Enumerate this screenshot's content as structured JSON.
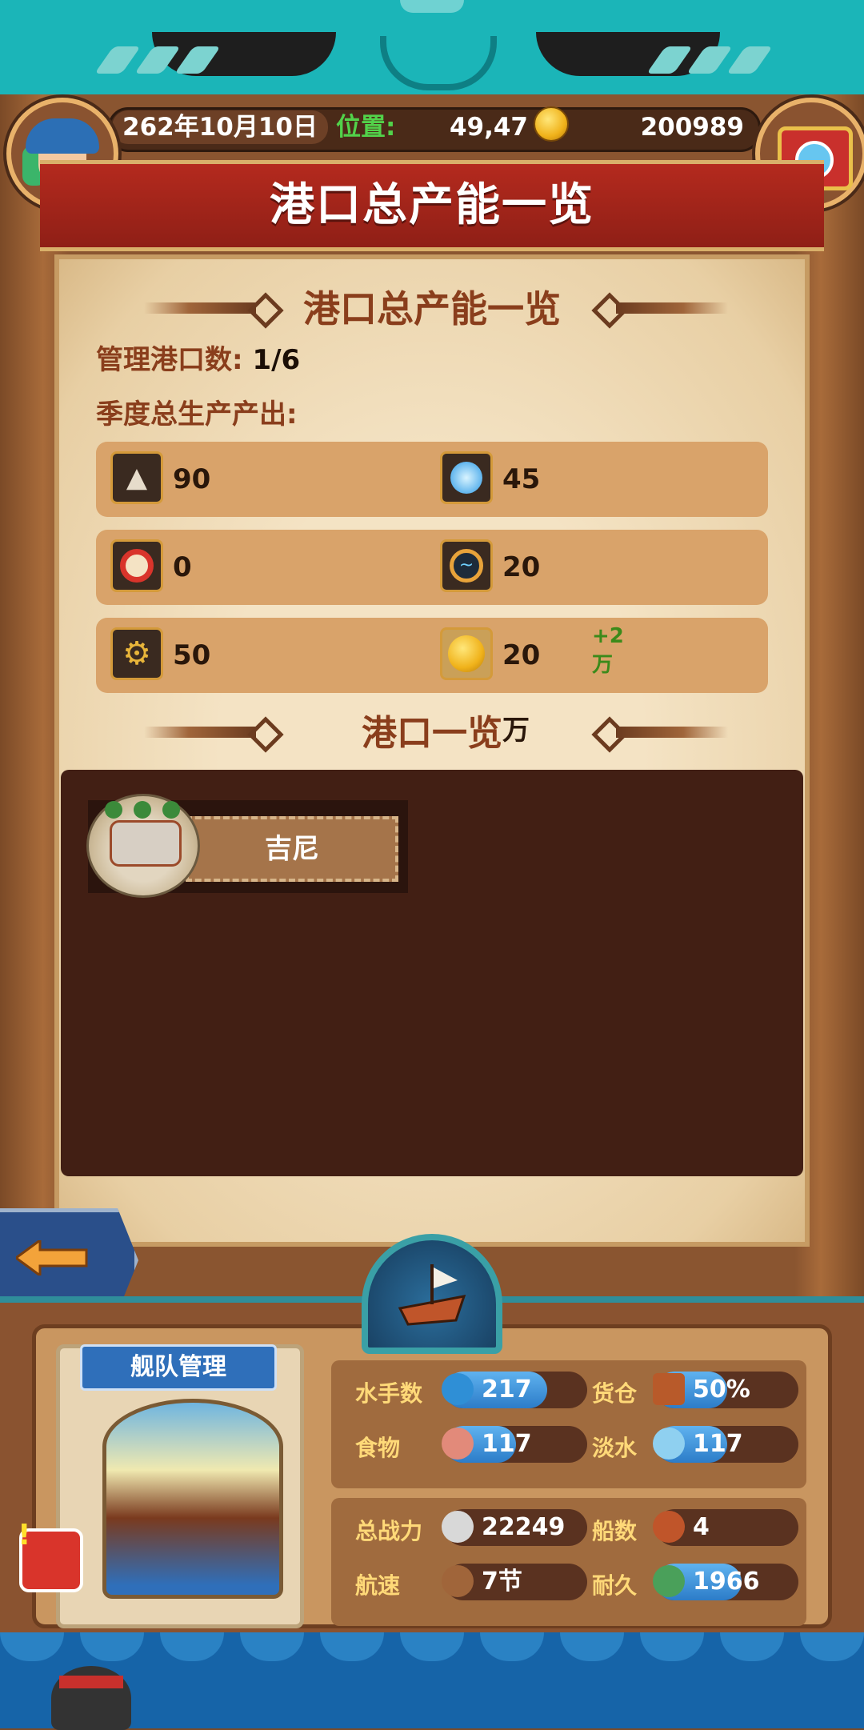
{
  "status": {
    "date": "262年10月10日",
    "position_label": "位置:",
    "position_value": "49,47",
    "gold": "200989"
  },
  "page_title": "港口总产能一览",
  "summary": {
    "heading": "港口总产能一览",
    "managed_label": "管理港口数:",
    "managed_value": "1/6",
    "output_label": "季度总生产产出:"
  },
  "resources": [
    {
      "icon": "stone-icon",
      "value": "90"
    },
    {
      "icon": "crystal-icon",
      "value": "45"
    },
    {
      "icon": "gear-badge-icon",
      "value": "0"
    },
    {
      "icon": "wind-icon",
      "value": "20"
    },
    {
      "icon": "cog-icon",
      "value": "50"
    },
    {
      "icon": "gold-coin-icon",
      "value": "20万",
      "bonus": "+2万"
    }
  ],
  "ports_section": {
    "heading": "港口一览",
    "ports": [
      {
        "name": "吉尼"
      }
    ]
  },
  "fleet": {
    "title": "舰队管理",
    "stats_top": [
      {
        "label": "水手数",
        "value": "217",
        "fill": 0.72
      },
      {
        "label": "货仓",
        "value": "50%",
        "fill": 0.5
      },
      {
        "label": "食物",
        "value": "117",
        "fill": 0.5
      },
      {
        "label": "淡水",
        "value": "117",
        "fill": 0.5
      }
    ],
    "stats_bottom": [
      {
        "label": "总战力",
        "value": "22249"
      },
      {
        "label": "船数",
        "value": "4"
      },
      {
        "label": "航速",
        "value": "7节"
      },
      {
        "label": "耐久",
        "value": "1966",
        "fill": 0.6
      }
    ]
  },
  "colors": {
    "title_red": "#b42a1e",
    "heading_brown": "#8a3e1c",
    "bonus_green": "#3b8a1a",
    "position_green": "#52d24a",
    "bar_blue": "#2c7cc8"
  }
}
